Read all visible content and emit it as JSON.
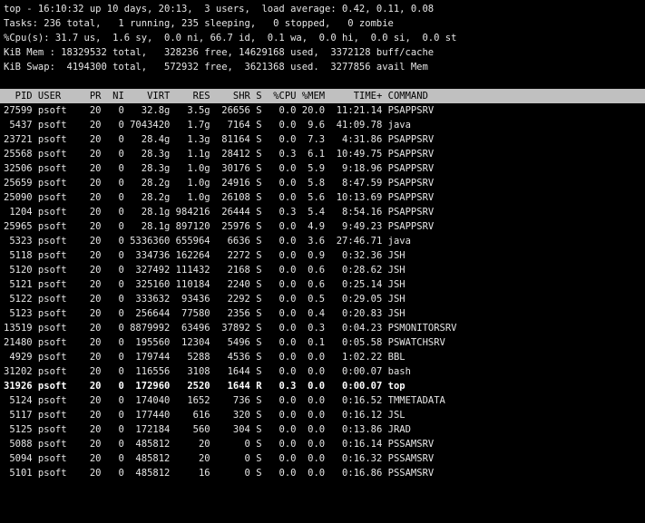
{
  "summary": {
    "uptime_line": "top - 16:10:32 up 10 days, 20:13,  3 users,  load average: 0.42, 0.11, 0.08",
    "tasks_line": "Tasks: 236 total,   1 running, 235 sleeping,   0 stopped,   0 zombie",
    "cpu_line": "%Cpu(s): 31.7 us,  1.6 sy,  0.0 ni, 66.7 id,  0.1 wa,  0.0 hi,  0.0 si,  0.0 st",
    "mem_line": "KiB Mem : 18329532 total,   328236 free, 14629168 used,  3372128 buff/cache",
    "swap_line": "KiB Swap:  4194300 total,   572932 free,  3621368 used.  3277856 avail Mem"
  },
  "columns": [
    "PID",
    "USER",
    "PR",
    "NI",
    "VIRT",
    "RES",
    "SHR",
    "S",
    "%CPU",
    "%MEM",
    "TIME+",
    "COMMAND"
  ],
  "processes": [
    {
      "pid": "27599",
      "user": "psoft",
      "pr": "20",
      "ni": "0",
      "virt": "32.8g",
      "res": "3.5g",
      "shr": "26656",
      "s": "S",
      "cpu": "0.0",
      "mem": "20.0",
      "time": "11:21.14",
      "command": "PSAPPSRV"
    },
    {
      "pid": "5437",
      "user": "psoft",
      "pr": "20",
      "ni": "0",
      "virt": "7043420",
      "res": "1.7g",
      "shr": "7164",
      "s": "S",
      "cpu": "0.0",
      "mem": "9.6",
      "time": "41:09.78",
      "command": "java"
    },
    {
      "pid": "23721",
      "user": "psoft",
      "pr": "20",
      "ni": "0",
      "virt": "28.4g",
      "res": "1.3g",
      "shr": "81164",
      "s": "S",
      "cpu": "0.0",
      "mem": "7.3",
      "time": "4:31.86",
      "command": "PSAPPSRV"
    },
    {
      "pid": "25568",
      "user": "psoft",
      "pr": "20",
      "ni": "0",
      "virt": "28.3g",
      "res": "1.1g",
      "shr": "28412",
      "s": "S",
      "cpu": "0.3",
      "mem": "6.1",
      "time": "10:49.75",
      "command": "PSAPPSRV"
    },
    {
      "pid": "32506",
      "user": "psoft",
      "pr": "20",
      "ni": "0",
      "virt": "28.3g",
      "res": "1.0g",
      "shr": "30176",
      "s": "S",
      "cpu": "0.0",
      "mem": "5.9",
      "time": "9:18.96",
      "command": "PSAPPSRV"
    },
    {
      "pid": "25659",
      "user": "psoft",
      "pr": "20",
      "ni": "0",
      "virt": "28.2g",
      "res": "1.0g",
      "shr": "24916",
      "s": "S",
      "cpu": "0.0",
      "mem": "5.8",
      "time": "8:47.59",
      "command": "PSAPPSRV"
    },
    {
      "pid": "25090",
      "user": "psoft",
      "pr": "20",
      "ni": "0",
      "virt": "28.2g",
      "res": "1.0g",
      "shr": "26108",
      "s": "S",
      "cpu": "0.0",
      "mem": "5.6",
      "time": "10:13.69",
      "command": "PSAPPSRV"
    },
    {
      "pid": "1204",
      "user": "psoft",
      "pr": "20",
      "ni": "0",
      "virt": "28.1g",
      "res": "984216",
      "shr": "26444",
      "s": "S",
      "cpu": "0.3",
      "mem": "5.4",
      "time": "8:54.16",
      "command": "PSAPPSRV"
    },
    {
      "pid": "25965",
      "user": "psoft",
      "pr": "20",
      "ni": "0",
      "virt": "28.1g",
      "res": "897120",
      "shr": "25976",
      "s": "S",
      "cpu": "0.0",
      "mem": "4.9",
      "time": "9:49.23",
      "command": "PSAPPSRV"
    },
    {
      "pid": "5323",
      "user": "psoft",
      "pr": "20",
      "ni": "0",
      "virt": "5336360",
      "res": "655964",
      "shr": "6636",
      "s": "S",
      "cpu": "0.0",
      "mem": "3.6",
      "time": "27:46.71",
      "command": "java"
    },
    {
      "pid": "5118",
      "user": "psoft",
      "pr": "20",
      "ni": "0",
      "virt": "334736",
      "res": "162264",
      "shr": "2272",
      "s": "S",
      "cpu": "0.0",
      "mem": "0.9",
      "time": "0:32.36",
      "command": "JSH"
    },
    {
      "pid": "5120",
      "user": "psoft",
      "pr": "20",
      "ni": "0",
      "virt": "327492",
      "res": "111432",
      "shr": "2168",
      "s": "S",
      "cpu": "0.0",
      "mem": "0.6",
      "time": "0:28.62",
      "command": "JSH"
    },
    {
      "pid": "5121",
      "user": "psoft",
      "pr": "20",
      "ni": "0",
      "virt": "325160",
      "res": "110184",
      "shr": "2240",
      "s": "S",
      "cpu": "0.0",
      "mem": "0.6",
      "time": "0:25.14",
      "command": "JSH"
    },
    {
      "pid": "5122",
      "user": "psoft",
      "pr": "20",
      "ni": "0",
      "virt": "333632",
      "res": "93436",
      "shr": "2292",
      "s": "S",
      "cpu": "0.0",
      "mem": "0.5",
      "time": "0:29.05",
      "command": "JSH"
    },
    {
      "pid": "5123",
      "user": "psoft",
      "pr": "20",
      "ni": "0",
      "virt": "256644",
      "res": "77580",
      "shr": "2356",
      "s": "S",
      "cpu": "0.0",
      "mem": "0.4",
      "time": "0:20.83",
      "command": "JSH"
    },
    {
      "pid": "13519",
      "user": "psoft",
      "pr": "20",
      "ni": "0",
      "virt": "8879992",
      "res": "63496",
      "shr": "37892",
      "s": "S",
      "cpu": "0.0",
      "mem": "0.3",
      "time": "0:04.23",
      "command": "PSMONITORSRV"
    },
    {
      "pid": "21480",
      "user": "psoft",
      "pr": "20",
      "ni": "0",
      "virt": "195560",
      "res": "12304",
      "shr": "5496",
      "s": "S",
      "cpu": "0.0",
      "mem": "0.1",
      "time": "0:05.58",
      "command": "PSWATCHSRV"
    },
    {
      "pid": "4929",
      "user": "psoft",
      "pr": "20",
      "ni": "0",
      "virt": "179744",
      "res": "5288",
      "shr": "4536",
      "s": "S",
      "cpu": "0.0",
      "mem": "0.0",
      "time": "1:02.22",
      "command": "BBL"
    },
    {
      "pid": "31202",
      "user": "psoft",
      "pr": "20",
      "ni": "0",
      "virt": "116556",
      "res": "3108",
      "shr": "1644",
      "s": "S",
      "cpu": "0.0",
      "mem": "0.0",
      "time": "0:00.07",
      "command": "bash"
    },
    {
      "pid": "31926",
      "user": "psoft",
      "pr": "20",
      "ni": "0",
      "virt": "172960",
      "res": "2520",
      "shr": "1644",
      "s": "R",
      "cpu": "0.3",
      "mem": "0.0",
      "time": "0:00.07",
      "command": "top",
      "bold": true
    },
    {
      "pid": "5124",
      "user": "psoft",
      "pr": "20",
      "ni": "0",
      "virt": "174040",
      "res": "1652",
      "shr": "736",
      "s": "S",
      "cpu": "0.0",
      "mem": "0.0",
      "time": "0:16.52",
      "command": "TMMETADATA"
    },
    {
      "pid": "5117",
      "user": "psoft",
      "pr": "20",
      "ni": "0",
      "virt": "177440",
      "res": "616",
      "shr": "320",
      "s": "S",
      "cpu": "0.0",
      "mem": "0.0",
      "time": "0:16.12",
      "command": "JSL"
    },
    {
      "pid": "5125",
      "user": "psoft",
      "pr": "20",
      "ni": "0",
      "virt": "172184",
      "res": "560",
      "shr": "304",
      "s": "S",
      "cpu": "0.0",
      "mem": "0.0",
      "time": "0:13.86",
      "command": "JRAD"
    },
    {
      "pid": "5088",
      "user": "psoft",
      "pr": "20",
      "ni": "0",
      "virt": "485812",
      "res": "20",
      "shr": "0",
      "s": "S",
      "cpu": "0.0",
      "mem": "0.0",
      "time": "0:16.14",
      "command": "PSSAMSRV"
    },
    {
      "pid": "5094",
      "user": "psoft",
      "pr": "20",
      "ni": "0",
      "virt": "485812",
      "res": "20",
      "shr": "0",
      "s": "S",
      "cpu": "0.0",
      "mem": "0.0",
      "time": "0:16.32",
      "command": "PSSAMSRV"
    },
    {
      "pid": "5101",
      "user": "psoft",
      "pr": "20",
      "ni": "0",
      "virt": "485812",
      "res": "16",
      "shr": "0",
      "s": "S",
      "cpu": "0.0",
      "mem": "0.0",
      "time": "0:16.86",
      "command": "PSSAMSRV"
    }
  ],
  "colors": {
    "background": "#000000",
    "foreground": "#e6e6e6",
    "header_bg": "#c0c0c0",
    "header_fg": "#000000"
  }
}
